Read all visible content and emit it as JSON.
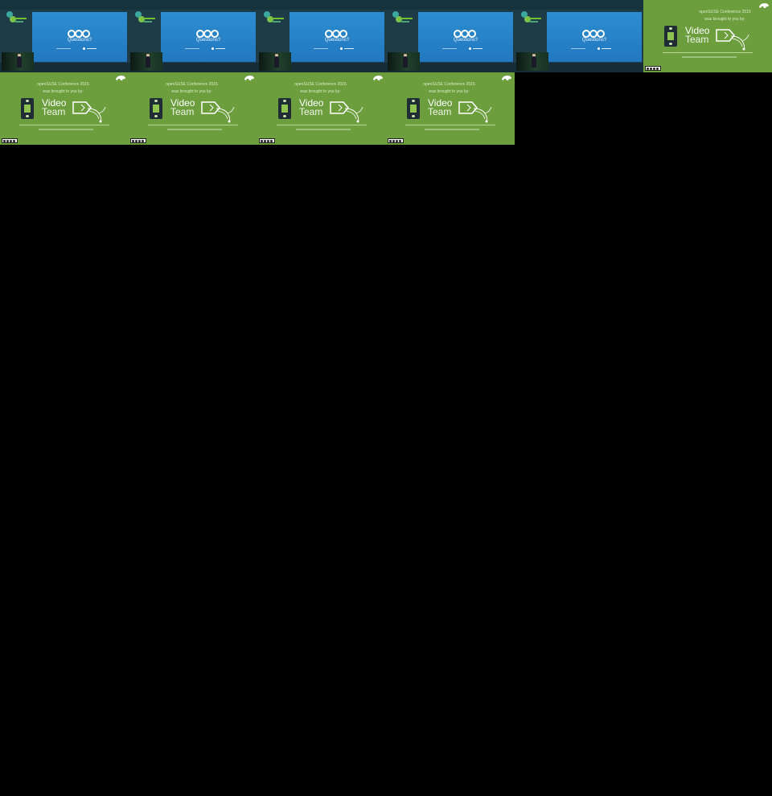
{
  "talk_frames": [
    {
      "slide_title": "Questions?"
    },
    {
      "slide_title": "Questions?"
    },
    {
      "slide_title": "Questions?"
    },
    {
      "slide_title": "Questions?"
    },
    {
      "slide_title": "Questions?"
    }
  ],
  "video_team_frames": [
    {
      "line1": "openSUSE Conference 2015",
      "line2": "was brought to you by:",
      "title_1": "Video",
      "title_2": "Team"
    },
    {
      "line1": "openSUSE Conference 2015",
      "line2": "was brought to you by:",
      "title_1": "Video",
      "title_2": "Team"
    },
    {
      "line1": "openSUSE Conference 2015",
      "line2": "was brought to you by:",
      "title_1": "Video",
      "title_2": "Team"
    },
    {
      "line1": "openSUSE Conference 2015",
      "line2": "was brought to you by:",
      "title_1": "Video",
      "title_2": "Team"
    },
    {
      "line1": "openSUSE Conference 2015",
      "line2": "was brought to you by:",
      "title_1": "Video",
      "title_2": "Team"
    }
  ],
  "colors": {
    "background": "#000000",
    "talk_background": "#1d3c48",
    "slide_blue": "#2278c0",
    "video_team_green": "#6c9e3d"
  },
  "icons": [
    "nextcloud-logo-icon",
    "conference-logo-icon",
    "film-strip-icon",
    "video-team-art-icon",
    "chameleon-icon",
    "cc-license-icon"
  ]
}
